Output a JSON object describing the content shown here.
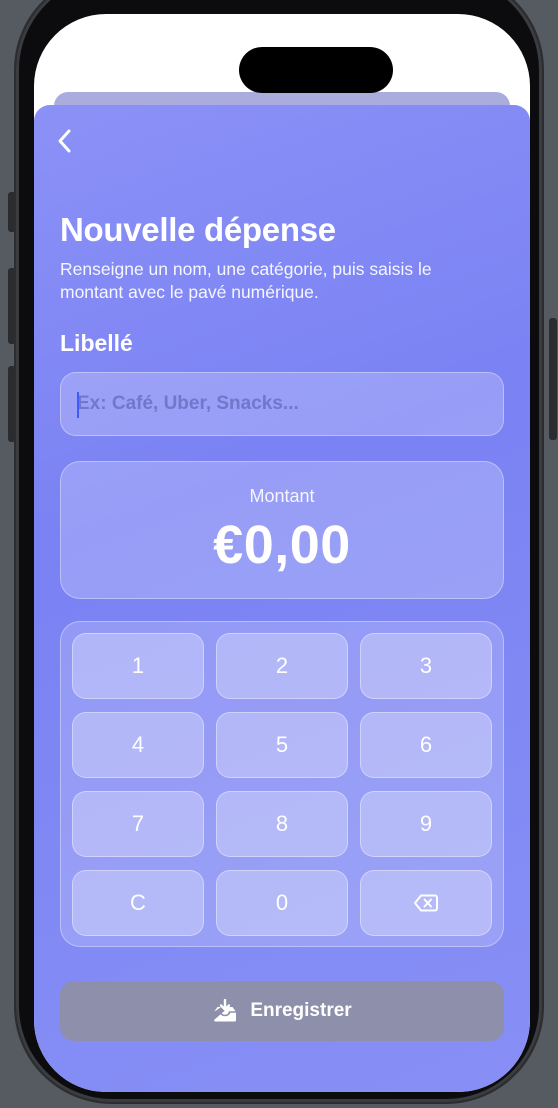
{
  "header": {
    "back_icon": "chevron-left-icon"
  },
  "title": "Nouvelle dépense",
  "subtitle": "Renseigne un nom, une catégorie, puis saisis le montant avec le pavé numérique.",
  "label_field": {
    "label": "Libellé",
    "placeholder": "Ex: Café, Uber, Snacks...",
    "value": ""
  },
  "amount": {
    "label": "Montant",
    "value": "€0,00"
  },
  "keypad": {
    "keys": [
      "1",
      "2",
      "3",
      "4",
      "5",
      "6",
      "7",
      "8",
      "9",
      "C",
      "0"
    ],
    "delete_icon": "backspace-icon"
  },
  "save_button": {
    "label": "Enregistrer",
    "icon": "tray-download-icon"
  },
  "colors": {
    "sheet": "#7a82f4",
    "caret": "#3d5bf5",
    "save_button": "#8e90ab"
  }
}
